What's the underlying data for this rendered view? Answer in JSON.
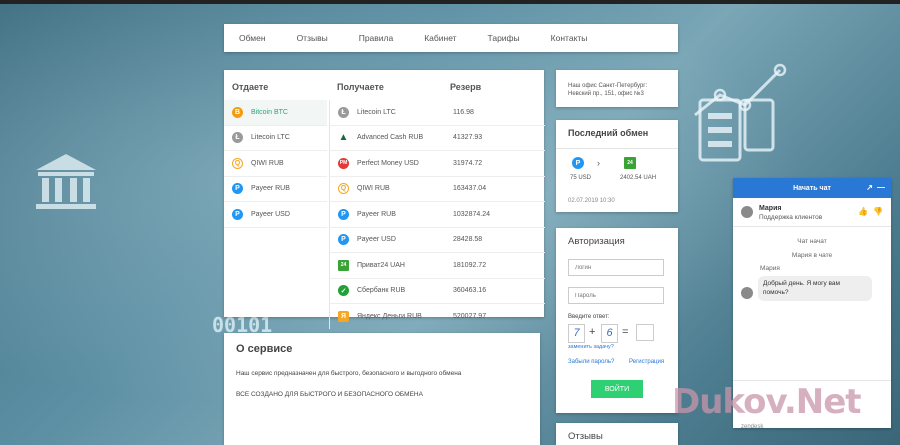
{
  "nav": {
    "items": [
      "Обмен",
      "Отзывы",
      "Правила",
      "Кабинет",
      "Тарифы",
      "Контакты"
    ]
  },
  "exchange": {
    "headers": {
      "give": "Отдаете",
      "get": "Получаете",
      "reserve": "Резерв"
    },
    "give": [
      {
        "label": "Bitcoin BTC",
        "icon": "bitcoin-icon",
        "color": "#f39c12",
        "glyph": "B",
        "selected": true
      },
      {
        "label": "Litecoin LTC",
        "icon": "litecoin-icon",
        "color": "#9a9a9a",
        "glyph": "Ł",
        "selected": false
      },
      {
        "label": "QIWI RUB",
        "icon": "qiwi-icon",
        "color": "#f5a623",
        "glyph": "Q",
        "selected": false
      },
      {
        "label": "Payeer RUB",
        "icon": "payeer-icon",
        "color": "#2196f3",
        "glyph": "P",
        "selected": false
      },
      {
        "label": "Payeer USD",
        "icon": "payeer-icon",
        "color": "#2196f3",
        "glyph": "P",
        "selected": false
      }
    ],
    "get": [
      {
        "label": "Litecoin LTC",
        "reserve": "116.98",
        "icon": "litecoin-icon",
        "color": "#9a9a9a",
        "glyph": "Ł"
      },
      {
        "label": "Advanced Cash RUB",
        "reserve": "41327.93",
        "icon": "advcash-icon",
        "color": "#1a6b3a",
        "glyph": "A"
      },
      {
        "label": "Perfect Money USD",
        "reserve": "31974.72",
        "icon": "perfect-money-icon",
        "color": "#e53935",
        "glyph": "PM"
      },
      {
        "label": "QIWI RUB",
        "reserve": "163437.04",
        "icon": "qiwi-icon",
        "color": "#f5a623",
        "glyph": "Q"
      },
      {
        "label": "Payeer RUB",
        "reserve": "1032874.24",
        "icon": "payeer-icon",
        "color": "#2196f3",
        "glyph": "P"
      },
      {
        "label": "Payeer USD",
        "reserve": "28428.58",
        "icon": "payeer-icon",
        "color": "#2196f3",
        "glyph": "P"
      },
      {
        "label": "Приват24 UAH",
        "reserve": "181092.72",
        "icon": "privat24-icon",
        "color": "#3aa335",
        "glyph": "24"
      },
      {
        "label": "Сбербанк RUB",
        "reserve": "360463.16",
        "icon": "sberbank-icon",
        "color": "#21a038",
        "glyph": "С"
      },
      {
        "label": "Яндекс Деньги RUB",
        "reserve": "520027.97",
        "icon": "yandex-money-icon",
        "color": "#f5a623",
        "glyph": "Я"
      }
    ]
  },
  "about": {
    "title": "О сервисе",
    "text1": "Наш сервис предназначен для быстрого, безопасного и выгодного обмена",
    "text2": "ВСЕ СОЗДАНО ДЛЯ БЫСТРОГО И БЕЗОПАСНОГО ОБМЕНА"
  },
  "office": {
    "text": "Наш офис Санкт-Петербург: Невский пр., 151, офис №3"
  },
  "last_exchange": {
    "title": "Последний обмен",
    "from_amount": "75 USD",
    "to_amount": "2402.54 UAH",
    "arrow": "›",
    "date": "02.07.2019 10:30"
  },
  "auth": {
    "title": "Авторизация",
    "login_placeholder": "Логин",
    "password_placeholder": "Пароль",
    "captcha_label": "Введите ответ:",
    "captcha_a": "7",
    "captcha_op": "+",
    "captcha_b": "6",
    "captcha_eq": "=",
    "change_task": "заменить задачу?",
    "forgot": "Забыли пароль?",
    "register": "Регистрация",
    "login_button": "ВОЙТИ"
  },
  "reviews": {
    "title": "Отзывы"
  },
  "chat": {
    "header": "Начать чат",
    "agent_name": "Мария",
    "agent_role": "Поддержка клиентов",
    "system_msg": "Чат начат",
    "joined_msg": "Мария в чате",
    "sender": "Мария",
    "message": "Добрый день. Я могу вам помочь?",
    "footer": "zendesk"
  },
  "decor": {
    "binary": "00101"
  },
  "watermark": "Dukov.Net",
  "colors": {
    "accent": "#2fcf74",
    "chat_header": "#2a78d6",
    "link": "#2a78d6"
  }
}
